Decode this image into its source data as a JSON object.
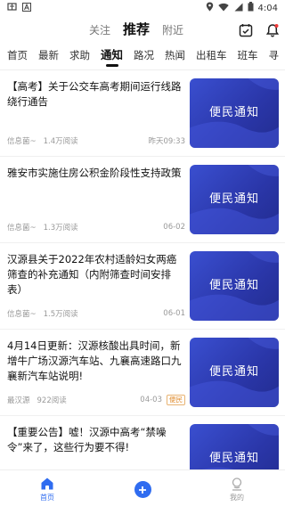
{
  "status_bar": {
    "time": "4:04"
  },
  "header": {
    "tabs": [
      {
        "label": "关注"
      },
      {
        "label": "推荐"
      },
      {
        "label": "附近"
      }
    ]
  },
  "categories": [
    {
      "label": "首页"
    },
    {
      "label": "最新"
    },
    {
      "label": "求助"
    },
    {
      "label": "通知"
    },
    {
      "label": "路况"
    },
    {
      "label": "热闻"
    },
    {
      "label": "出租车"
    },
    {
      "label": "班车"
    },
    {
      "label": "寻"
    }
  ],
  "thumb_text": "便民通知",
  "news": [
    {
      "title": "【高考】关于公交车高考期间运行线路绕行通告",
      "source": "信息菌~",
      "reads": "1.4万阅读",
      "time": "昨天09:33",
      "tag": ""
    },
    {
      "title": "雅安市实施住房公积金阶段性支持政策",
      "source": "信息菌~",
      "reads": "1.3万阅读",
      "time": "06-02",
      "tag": ""
    },
    {
      "title": "汉源县关于2022年农村适龄妇女两癌筛查的补充通知（内附筛查时间安排表）",
      "source": "信息菌~",
      "reads": "1.5万阅读",
      "time": "06-01",
      "tag": ""
    },
    {
      "title": "4月14日更新：汉源核酸出具时间，新增牛广场汉源汽车站、九襄高速路口九襄新汽车站说明!",
      "source": "最汉源",
      "reads": "922阅读",
      "time": "04-03",
      "tag": "便民"
    },
    {
      "title": "【重要公告】嘘！汉源中高考“禁噪令”来了，这些行为要不得!",
      "source": "",
      "reads": "",
      "time": "",
      "tag": ""
    }
  ],
  "bottom_nav": {
    "home_label": "首页",
    "me_label": "我的"
  },
  "colors": {
    "accent": "#2f6cf0",
    "thumb": "#2f3cb8",
    "tag": "#e08b2c"
  }
}
